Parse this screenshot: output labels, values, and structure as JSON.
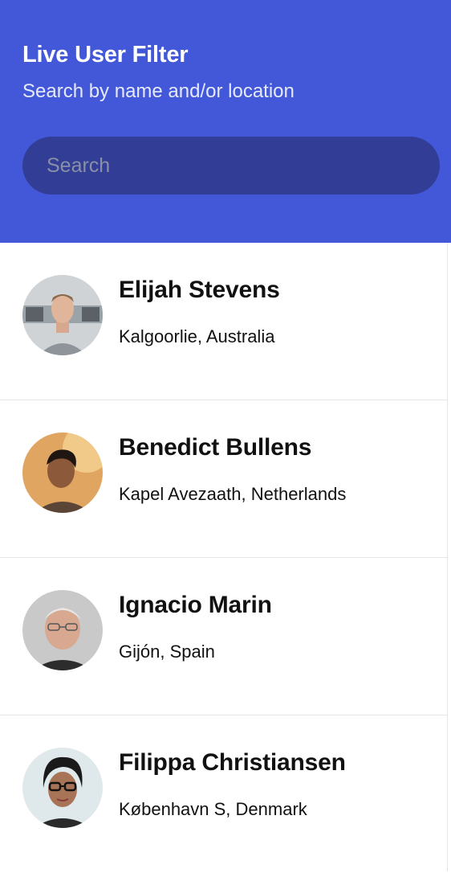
{
  "header": {
    "title": "Live User Filter",
    "subtitle": "Search by name and/or location",
    "search_placeholder": "Search"
  },
  "users": [
    {
      "name": "Elijah Stevens",
      "location": "Kalgoorlie, Australia"
    },
    {
      "name": "Benedict Bullens",
      "location": "Kapel Avezaath, Netherlands"
    },
    {
      "name": "Ignacio Marin",
      "location": "Gijón, Spain"
    },
    {
      "name": "Filippa Christiansen",
      "location": "København S, Denmark"
    }
  ],
  "colors": {
    "header_bg": "#4258d8",
    "search_bg": "#323e96"
  }
}
